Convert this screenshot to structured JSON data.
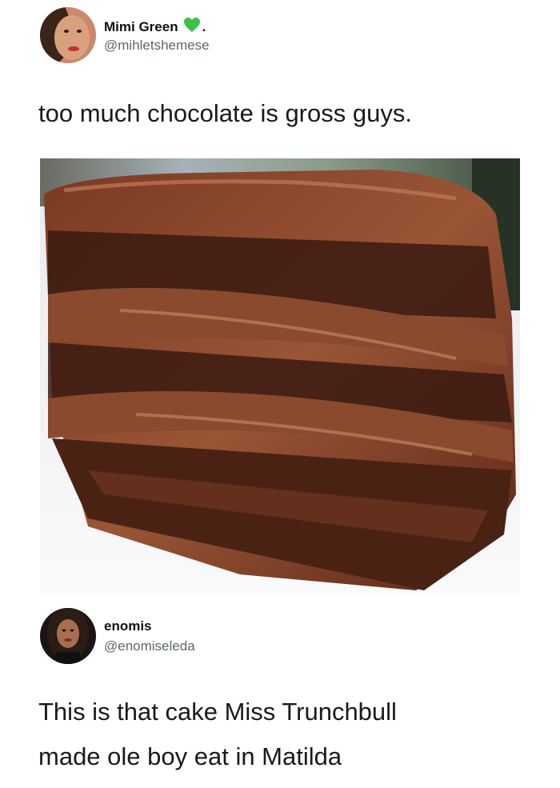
{
  "tweet1": {
    "display_name": "Mimi Green",
    "name_suffix": ".",
    "handle": "@mihletshemese",
    "text": "too much chocolate is gross guys.",
    "badge_icon": "green-heart-icon",
    "badge_color": "#3cc04a"
  },
  "tweet2": {
    "display_name": "enomis",
    "handle": "@enomiseleda",
    "text_line1": "This is that cake Miss Trunchbull",
    "text_line2": "made ole boy eat in Matilda"
  },
  "colors": {
    "chocolate_dark": "#3a1a10",
    "chocolate_mid": "#6b3320",
    "chocolate_glossy": "#8a4a2e",
    "plate": "#f2f2f4"
  }
}
